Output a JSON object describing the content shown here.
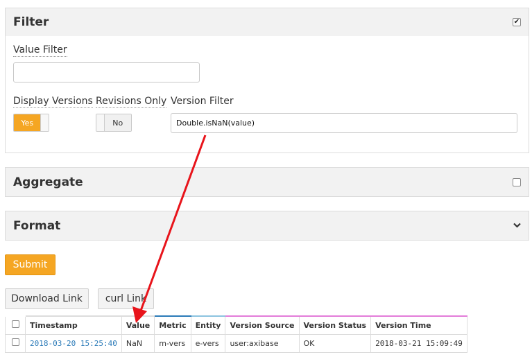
{
  "filter": {
    "title": "Filter",
    "checked": true,
    "value_filter_label": "Value Filter",
    "value_filter_value": "",
    "display_versions_label": "Display Versions",
    "display_versions_toggle": "Yes",
    "revisions_only_label": "Revisions Only",
    "revisions_only_toggle": "No",
    "version_filter_label": "Version Filter",
    "version_filter_value": "Double.isNaN(value)"
  },
  "aggregate": {
    "title": "Aggregate",
    "checked": false
  },
  "format": {
    "title": "Format",
    "icon": "chevron-down-icon"
  },
  "buttons": {
    "submit": "Submit",
    "download_link": "Download Link",
    "curl_link": "curl Link"
  },
  "table": {
    "headers": [
      "Timestamp",
      "Value",
      "Metric",
      "Entity",
      "Version Source",
      "Version Status",
      "Version Time"
    ],
    "header_accents": [
      "#ffffff",
      "#ffffff",
      "#2a7ab8",
      "#8cc3e0",
      "#e37cd9",
      "#e37cd9",
      "#e37cd9"
    ],
    "rows": [
      {
        "timestamp": "2018-03-20 15:25:40",
        "value": "NaN",
        "metric": "m-vers",
        "entity": "e-vers",
        "version_source": "user:axibase",
        "version_status": "OK",
        "version_time": "2018-03-21 15:09:49"
      }
    ]
  },
  "colors": {
    "accent": "#f5a623",
    "link": "#2a7ab8",
    "arrow": "#e8141b"
  }
}
